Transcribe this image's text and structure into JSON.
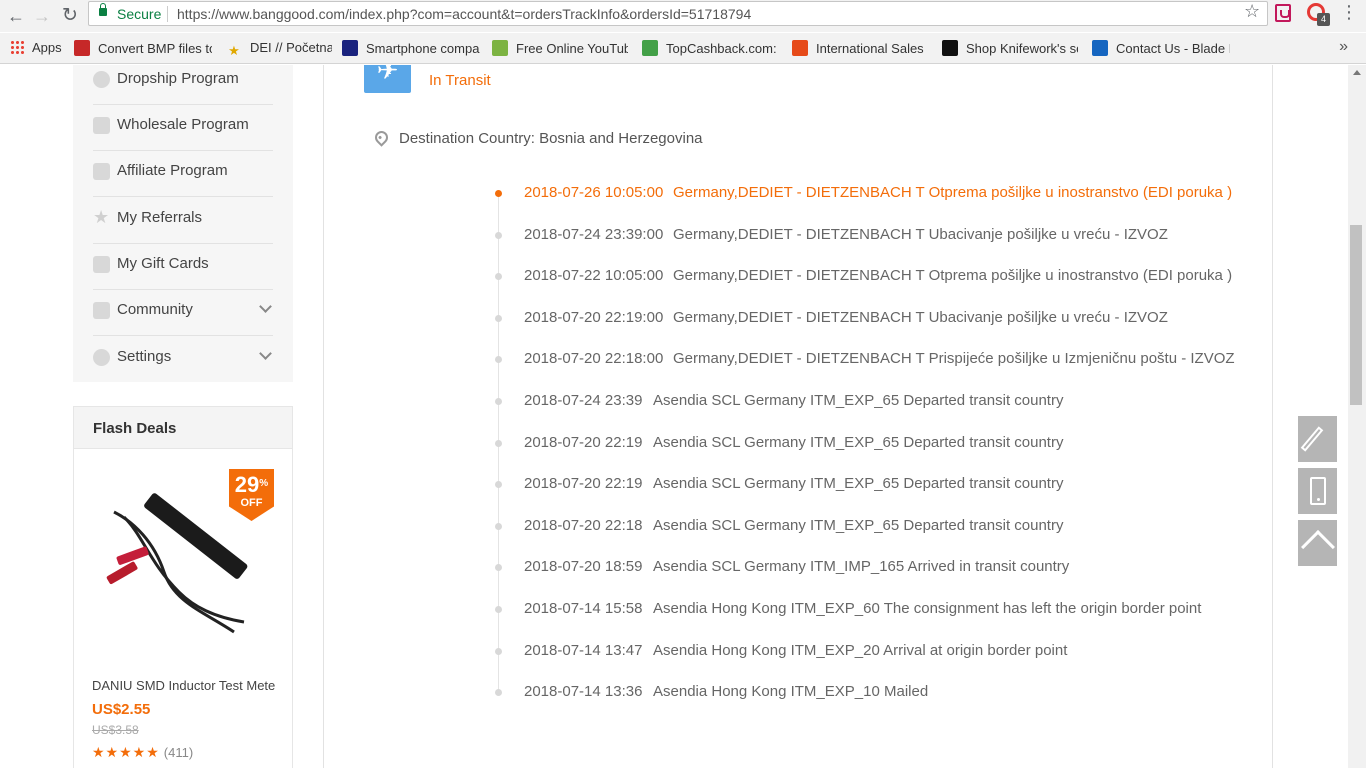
{
  "browser": {
    "secure_label": "Secure",
    "url": "https://www.banggood.com/index.php?com=account&t=ordersTrackInfo&ordersId=51718794",
    "extension_badge": "4"
  },
  "bookmarks": [
    {
      "label": "Apps",
      "icon": "apps-grid-icon"
    },
    {
      "label": "Convert BMP files to",
      "icon": "pdf-icon",
      "color": "#c62828"
    },
    {
      "label": "DEI // Početna",
      "icon": "star-logo-icon",
      "color": "#333333"
    },
    {
      "label": "Smartphone compar",
      "icon": "ki-logo-icon",
      "color": "#1a237e"
    },
    {
      "label": "Free Online YouTube",
      "icon": "download-arrow-icon",
      "color": "#7cb342"
    },
    {
      "label": "TopCashback.com: T",
      "icon": "topcashback-icon",
      "color": "#43a047"
    },
    {
      "label": "International Sales -",
      "icon": "sales-icon",
      "color": "#e64a19"
    },
    {
      "label": "Shop Knifework's se",
      "icon": "knifework-icon",
      "color": "#111111"
    },
    {
      "label": "Contact Us - Blade H",
      "icon": "blade-icon",
      "color": "#1565c0"
    }
  ],
  "sidebar": {
    "items": [
      {
        "label": "Dropship Program",
        "icon": "dropship-icon"
      },
      {
        "label": "Wholesale Program",
        "icon": "wholesale-icon"
      },
      {
        "label": "Affiliate Program",
        "icon": "affiliate-icon"
      },
      {
        "label": "My Referrals",
        "icon": "star-icon"
      },
      {
        "label": "My Gift Cards",
        "icon": "gift-icon"
      },
      {
        "label": "Community",
        "icon": "grid-icon",
        "expandable": true
      },
      {
        "label": "Settings",
        "icon": "gear-icon",
        "expandable": true
      }
    ]
  },
  "flash_deals": {
    "title": "Flash Deals",
    "discount": "29",
    "discount_unit": "%",
    "discount_off": "OFF",
    "product_name": "DANIU SMD Inductor Test Mete...",
    "price": "US$2.55",
    "old_price": "US$3.58",
    "stars": "★★★★★",
    "rating_count": "(411)"
  },
  "tracking": {
    "status": "In Transit",
    "destination": "Destination Country: Bosnia and Herzegovina",
    "events": [
      {
        "time": "2018-07-26 10:05:00",
        "desc": "Germany,DEDIET - DIETZENBACH T Otprema pošiljke u inostranstvo (EDI poruka )"
      },
      {
        "time": "2018-07-24 23:39:00",
        "desc": "Germany,DEDIET - DIETZENBACH T Ubacivanje pošiljke u vreću - IZVOZ"
      },
      {
        "time": "2018-07-22 10:05:00",
        "desc": "Germany,DEDIET - DIETZENBACH T Otprema pošiljke u inostranstvo (EDI poruka )"
      },
      {
        "time": "2018-07-20 22:19:00",
        "desc": "Germany,DEDIET - DIETZENBACH T Ubacivanje pošiljke u vreću - IZVOZ"
      },
      {
        "time": "2018-07-20 22:18:00",
        "desc": "Germany,DEDIET - DIETZENBACH T Prispijeće pošiljke u Izmjeničnu poštu - IZVOZ"
      },
      {
        "time": "2018-07-24 23:39",
        "desc": "Asendia SCL Germany ITM_EXP_65 Departed transit country"
      },
      {
        "time": "2018-07-20 22:19",
        "desc": "Asendia SCL Germany ITM_EXP_65 Departed transit country"
      },
      {
        "time": "2018-07-20 22:19",
        "desc": "Asendia SCL Germany ITM_EXP_65 Departed transit country"
      },
      {
        "time": "2018-07-20 22:18",
        "desc": "Asendia SCL Germany ITM_EXP_65 Departed transit country"
      },
      {
        "time": "2018-07-20 18:59",
        "desc": "Asendia SCL Germany ITM_IMP_165 Arrived in transit country"
      },
      {
        "time": "2018-07-14 15:58",
        "desc": "Asendia Hong Kong ITM_EXP_60 The consignment has left the origin border point"
      },
      {
        "time": "2018-07-14 13:47",
        "desc": "Asendia Hong Kong ITM_EXP_20 Arrival at origin border point"
      },
      {
        "time": "2018-07-14 13:36",
        "desc": "Asendia Hong Kong ITM_EXP_10 Mailed"
      }
    ]
  },
  "colors": {
    "accent": "#f36d0a",
    "plane_box": "#5aa7e8",
    "float_tool": "#b5b5b5"
  }
}
